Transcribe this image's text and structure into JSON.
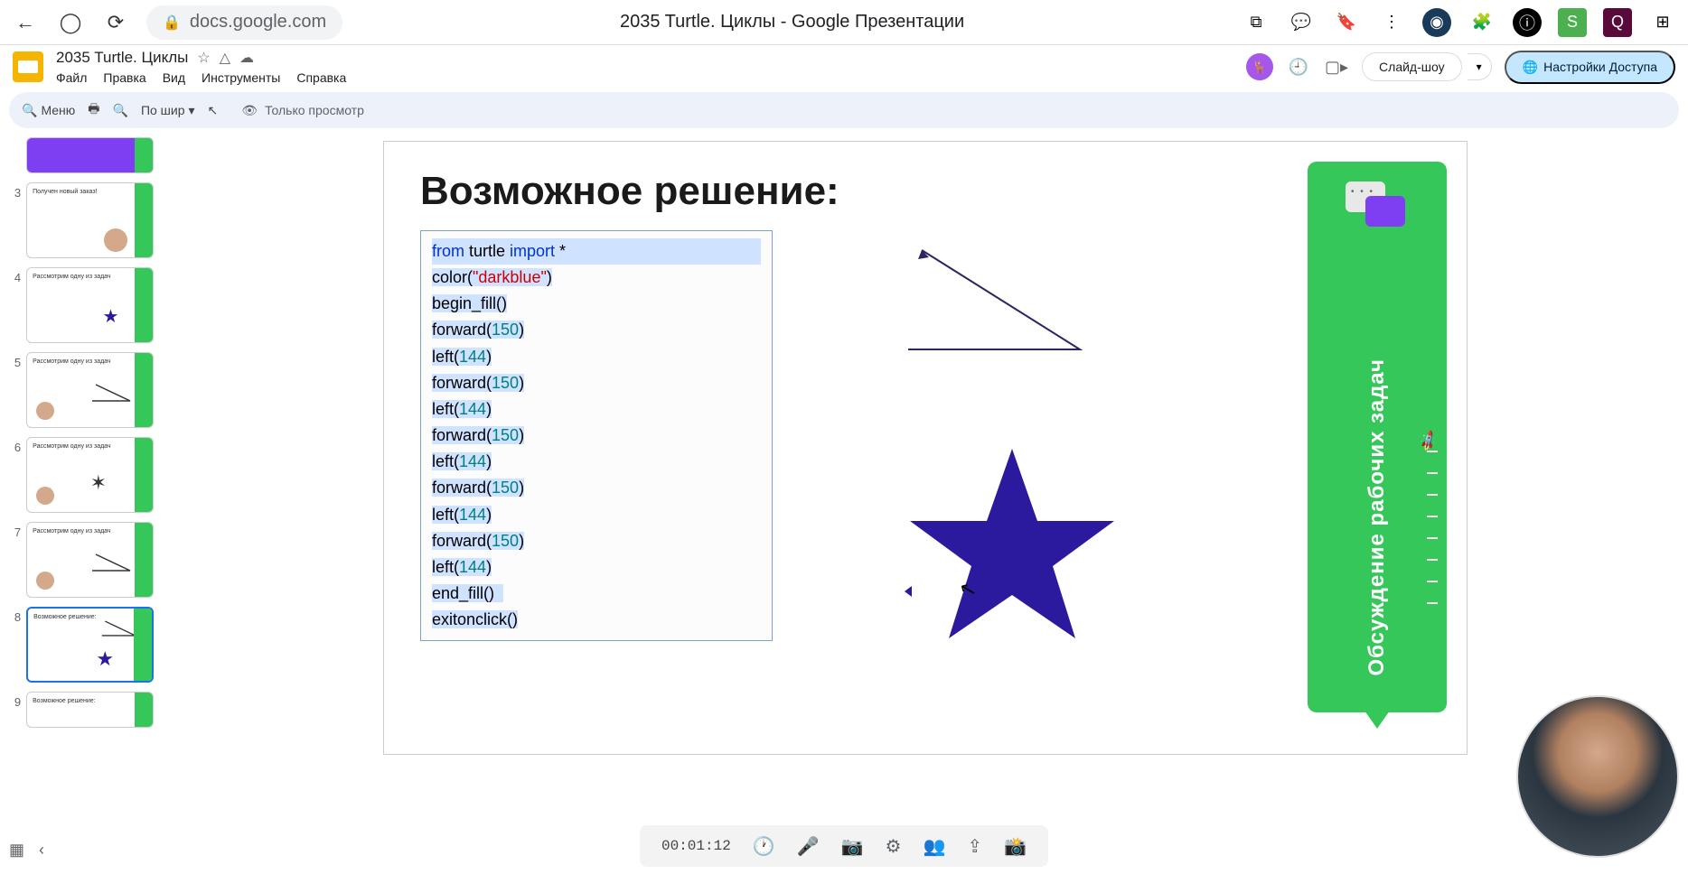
{
  "browser": {
    "url": "docs.google.com",
    "tab_title": "2035 Turtle. Циклы - Google Презентации"
  },
  "doc": {
    "title": "2035 Turtle. Циклы",
    "menus": [
      "Файл",
      "Правка",
      "Вид",
      "Инструменты",
      "Справка"
    ],
    "slideshow_label": "Слайд-шоу",
    "share_label": "Настройки Доступа"
  },
  "toolbar": {
    "menu_label": "Меню",
    "fit_label": "По шир",
    "view_only": "Только просмотр"
  },
  "thumbs": {
    "visible_numbers": [
      "3",
      "4",
      "5",
      "6",
      "7",
      "8",
      "9"
    ],
    "active": "8",
    "generic_label": "Рассмотрим одну из задач",
    "label_3": "Получен новый заказ!",
    "label_8": "Возможное решение:",
    "label_9": "Возможное решение:"
  },
  "slide": {
    "title": "Возможное решение:",
    "code": [
      "from turtle import *",
      "color(\"darkblue\")",
      "begin_fill()",
      "forward(150)",
      "left(144)",
      "forward(150)",
      "left(144)",
      "forward(150)",
      "left(144)",
      "forward(150)",
      "left(144)",
      "forward(150)",
      "left(144)",
      "end_fill()",
      "exitonclick()"
    ],
    "panel_text": "Обсуждение рабочих задач"
  },
  "conference": {
    "timer": "00:01:12"
  },
  "colors": {
    "accent_green": "#35c75a",
    "accent_purple": "#7e3ff2",
    "star": "#2b1a9e"
  }
}
